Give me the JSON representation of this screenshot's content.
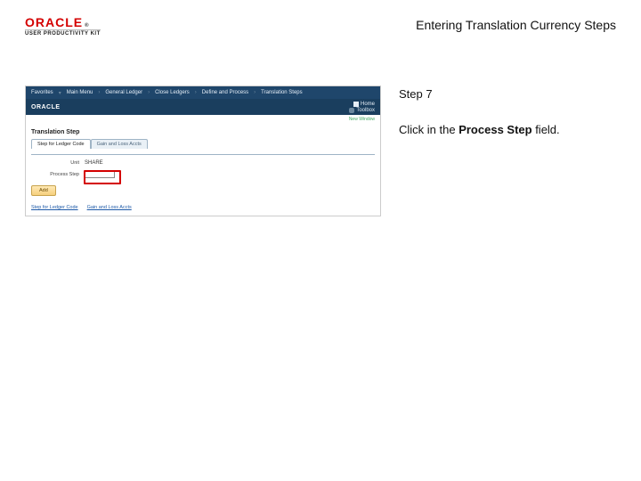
{
  "header": {
    "logo_brand": "ORACLE",
    "logo_sub": "USER PRODUCTIVITY KIT",
    "title": "Entering Translation Currency Steps"
  },
  "step": {
    "label": "Step 7",
    "instruction_prefix": "Click in the ",
    "instruction_bold": "Process Step",
    "instruction_suffix": " field."
  },
  "screenshot": {
    "nav": {
      "items": [
        "Favorites",
        "Main Menu",
        "General Ledger",
        "Close Ledgers",
        "Define and Process",
        "Translation Steps"
      ],
      "home": "Home"
    },
    "brand": "ORACLE",
    "toolbox_label": "Toolbox",
    "window_label": "New Window",
    "page_title": "Translation Step",
    "tabs": [
      "Step for Ledger Code",
      "Gain and Loss Accts"
    ],
    "fields": {
      "unit_label": "Unit",
      "unit_value": "SHARE",
      "process_step_label": "Process Step"
    },
    "add_button": "Add",
    "bottom_links": [
      "Step for Ledger Code",
      "Gain and Loss Accts"
    ]
  }
}
